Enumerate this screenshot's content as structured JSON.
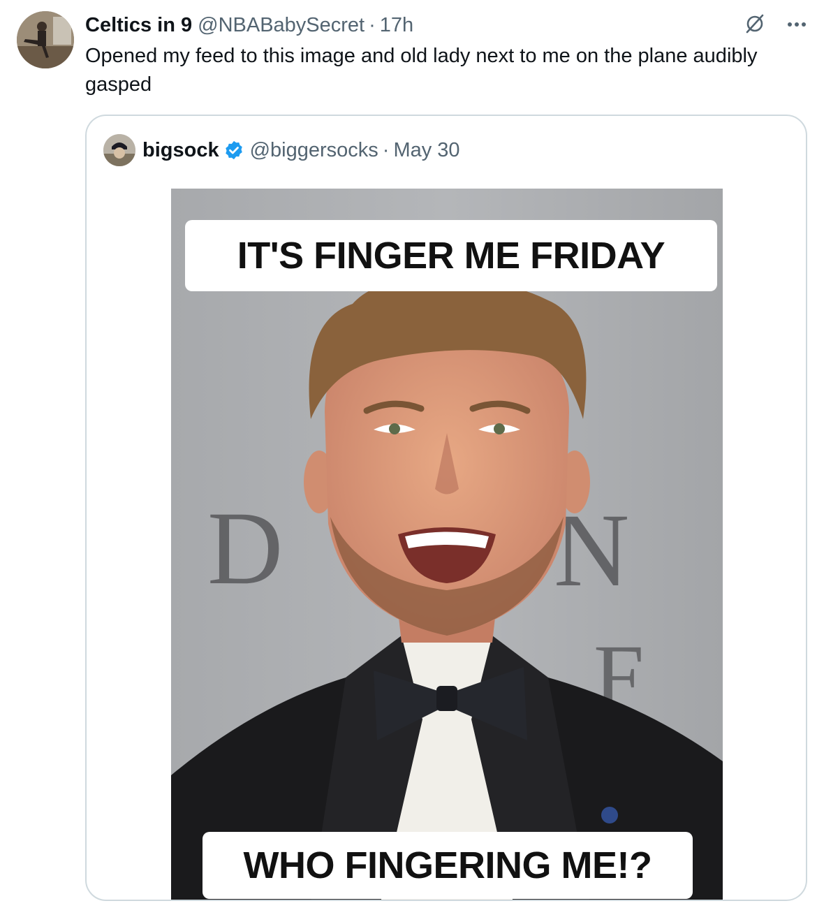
{
  "tweet": {
    "author_name": "Celtics in 9",
    "author_handle": "@NBABabySecret",
    "separator": "·",
    "time": "17h",
    "text": "Opened my feed to this image and old lady next to me on the plane audibly gasped"
  },
  "icons": {
    "grok": "slashed-circle-icon",
    "more": "more-dots-icon"
  },
  "quoted": {
    "author_name": "bigsock",
    "author_handle": "@biggersocks",
    "separator": "·",
    "date": "May 30",
    "verified": true,
    "image": {
      "caption_top": "IT'S FINGER ME FRIDAY",
      "caption_bottom": "WHO FINGERING ME!?",
      "backdrop_letters": [
        "D",
        "N",
        "F"
      ]
    }
  },
  "colors": {
    "text": "#0f1419",
    "secondary": "#536471",
    "border": "#cfd9de",
    "verified": "#1d9bf0"
  }
}
